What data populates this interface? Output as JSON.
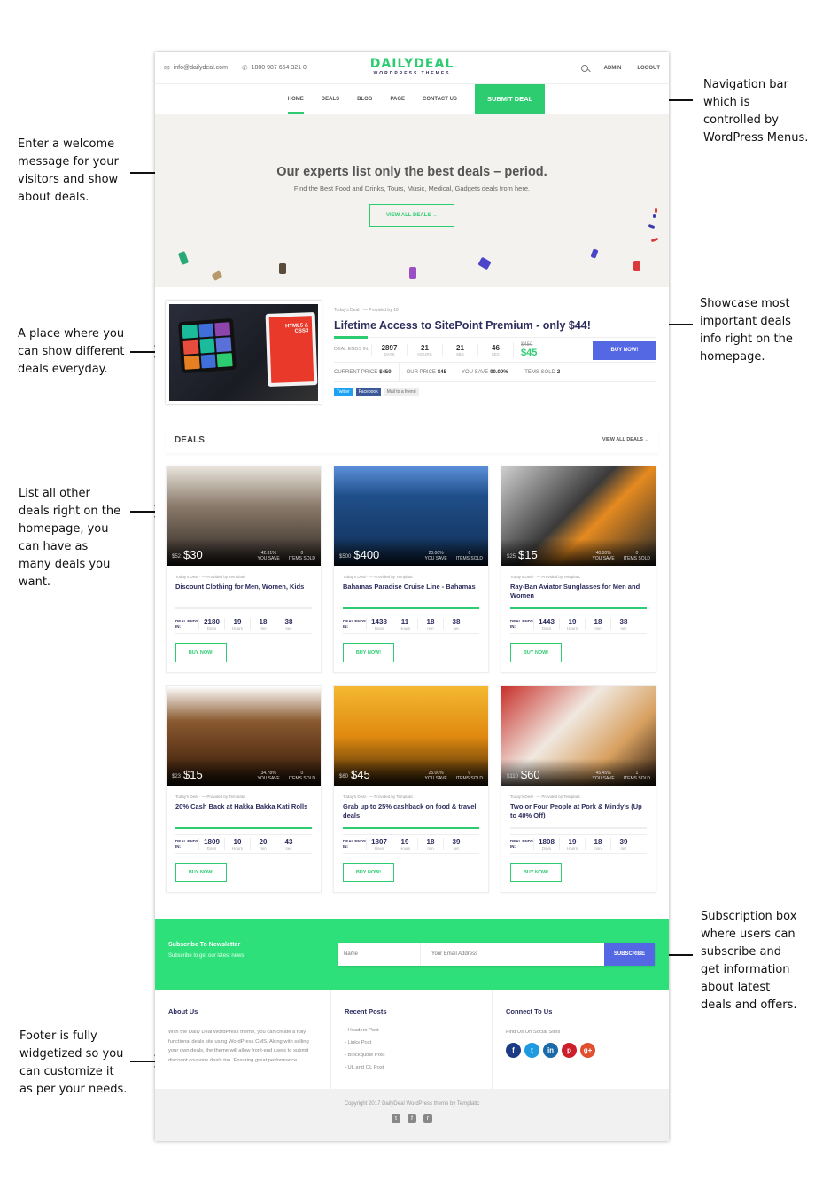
{
  "annotations": {
    "welcome": "Enter a welcome message for your visitors and show about deals.",
    "navbar": "Navigation bar which is controlled by WordPress Menus.",
    "daily_deal": "A place where you can show different deals everyday.",
    "showcase": "Showcase most important deals info right on the homepage.",
    "list_deals": "List all other deals right on the homepage, you can have as many deals you want.",
    "subscription": "Subscription box where users can subscribe and get information about latest deals and offers.",
    "footer": "Footer is fully widgetized so you can customize it as per your needs."
  },
  "topbar": {
    "email": "info@dailydeal.com",
    "phone": "1800 987 654 321 0",
    "logo_main": "DAILYDEAL",
    "logo_sub": "WORDPRESS THEMES",
    "admin": "ADMIN",
    "logout": "LOGOUT"
  },
  "nav": {
    "items": [
      "HOME",
      "DEALS",
      "BLOG",
      "PAGE",
      "CONTACT US"
    ],
    "active": "HOME",
    "submit": "SUBMIT DEAL"
  },
  "hero": {
    "title": "Our experts list only the best deals – period.",
    "subtitle": "Find the Best Food and Drinks, Tours, Music, Medical, Gadgets deals from here.",
    "button": "VIEW ALL DEALS →"
  },
  "featured": {
    "meta": "Today's Deal · — Provided by 10",
    "title": "Lifetime Access to SitePoint Premium - only $44!",
    "ends_label": "DEAL ENDS IN:",
    "timer": [
      {
        "n": "2897",
        "u": "DAYS"
      },
      {
        "n": "21",
        "u": "HOURS"
      },
      {
        "n": "21",
        "u": "MIN"
      },
      {
        "n": "46",
        "u": "SEC"
      }
    ],
    "old_price": "$450",
    "new_price": "$45",
    "buy": "BUY NOW!",
    "stats": {
      "current_label": "CURRENT PRICE",
      "current": "$450",
      "our_label": "OUR PRICE",
      "our": "$45",
      "save_label": "YOU SAVE",
      "save": "90.00%",
      "sold_label": "ITEMS SOLD",
      "sold": "2"
    },
    "share": {
      "twitter": "Twitter",
      "facebook": "Facebook",
      "mail": "Mail to a friend"
    },
    "image_text": "HTML5 & CSS3"
  },
  "deals_section": {
    "title": "DEALS",
    "view_all": "VIEW ALL DEALS →"
  },
  "deal_labels": {
    "you_save": "YOU SAVE",
    "items_sold": "ITEMS SOLD",
    "ends_label": "DEAL ENDS IN:",
    "units": [
      "Days",
      "Hours",
      "min",
      "sec"
    ],
    "buy": "BUY NOW!"
  },
  "deals": [
    {
      "old": "$52",
      "new": "$30",
      "save": "42.31%",
      "sold": "0",
      "meta": "Today's Deal · — Provided by Templatic",
      "title": "Discount Clothing for Men, Women, Kids",
      "progress": 0,
      "timer": [
        "2180",
        "19",
        "18",
        "38"
      ]
    },
    {
      "old": "$500",
      "new": "$400",
      "save": "20.00%",
      "sold": "0",
      "meta": "Today's Deal · — Provided by Templatic",
      "title": "Bahamas Paradise Cruise Line - Bahamas",
      "progress": 100,
      "timer": [
        "1438",
        "11",
        "18",
        "38"
      ]
    },
    {
      "old": "$25",
      "new": "$15",
      "save": "40.00%",
      "sold": "0",
      "meta": "Today's Deal · — Provided by Templatic",
      "title": "Ray-Ban Aviator Sunglasses for Men and Women",
      "progress": 100,
      "timer": [
        "1443",
        "19",
        "18",
        "38"
      ]
    },
    {
      "old": "$23",
      "new": "$15",
      "save": "34.78%",
      "sold": "0",
      "meta": "Today's Deal · — Provided by Templatic",
      "title": "20% Cash Back at Hakka Bakka Kati Rolls",
      "progress": 100,
      "timer": [
        "1809",
        "10",
        "20",
        "43"
      ]
    },
    {
      "old": "$60",
      "new": "$45",
      "save": "25.00%",
      "sold": "0",
      "meta": "Today's Deal · — Provided by Templatic",
      "title": "Grab up to 25% cashback on food & travel deals",
      "progress": 100,
      "timer": [
        "1807",
        "19",
        "18",
        "39"
      ]
    },
    {
      "old": "$110",
      "new": "$60",
      "save": "45.45%",
      "sold": "1",
      "meta": "Today's Deal · — Provided by Templatic",
      "title": "Two or Four People at Pork & Mindy's (Up to 40% Off)",
      "progress": 0,
      "timer": [
        "1808",
        "19",
        "18",
        "39"
      ]
    }
  ],
  "newsletter": {
    "title": "Subscribe To Newsletter",
    "subtitle": "Subscribe to get our latest news",
    "name_placeholder": "Name",
    "email_placeholder": "Your Email Address",
    "button": "SUBSCRIBE"
  },
  "footer": {
    "about_title": "About Us",
    "about_text": "With the Daily Deal WordPress theme, you can create a fully functional deals site using WordPress CMS. Along with selling your own deals, the theme will allow front-end users to submit discount coupons deals too. Ensuring great performance",
    "recent_title": "Recent Posts",
    "recent_posts": [
      "Headers Post",
      "Links Post",
      "Blockquote Post",
      "UL and OL Post"
    ],
    "connect_title": "Connect To Us",
    "connect_sub": "Find Us On Social Sites",
    "socials": [
      {
        "name": "facebook",
        "glyph": "f",
        "color": "#1b3c84"
      },
      {
        "name": "twitter",
        "glyph": "t",
        "color": "#1e9be0"
      },
      {
        "name": "linkedin",
        "glyph": "in",
        "color": "#1a6aa8"
      },
      {
        "name": "pinterest",
        "glyph": "p",
        "color": "#cc1f2a"
      },
      {
        "name": "google-plus",
        "glyph": "g+",
        "color": "#e0502f"
      }
    ],
    "copyright": "Copyright 2017 DailyDeal WordPress theme by Templatic",
    "bottom_icons": [
      {
        "name": "twitter",
        "glyph": "t"
      },
      {
        "name": "facebook",
        "glyph": "f"
      },
      {
        "name": "rss",
        "glyph": "r"
      }
    ]
  },
  "colors": {
    "accent": "#2ecc71",
    "buy_button": "#5468e4",
    "title": "#2d2d5e"
  }
}
